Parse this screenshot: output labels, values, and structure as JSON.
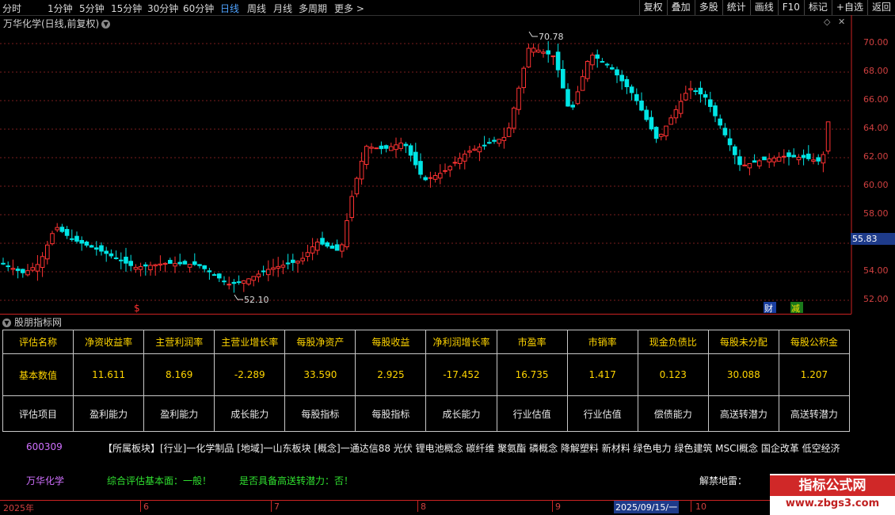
{
  "toolbar": {
    "timeframes": [
      "分时",
      "1分钟",
      "5分钟",
      "15分钟",
      "30分钟",
      "60分钟",
      "日线",
      "周线",
      "月线",
      "多周期",
      "更多 >"
    ],
    "active_timeframe": "日线",
    "buttons": [
      "复权",
      "叠加",
      "多股",
      "统计",
      "画线",
      "F10",
      "标记",
      "+自选",
      "返回"
    ]
  },
  "chart": {
    "title": "万华化学(日线,前复权)",
    "dropdown_icon": "chevron-down-icon",
    "high_label": "70.78",
    "low_label": "52.10",
    "current_price": "55.83",
    "y_ticks": [
      "70.00",
      "68.00",
      "66.00",
      "64.00",
      "62.00",
      "60.00",
      "58.00",
      "56.00",
      "54.00",
      "52.00"
    ],
    "markers": {
      "dividend": "$",
      "finance": "财",
      "reduce": "减"
    },
    "colors": {
      "up": "#ff3232",
      "down": "#00e5e5",
      "grid": "#7a1e1e",
      "axis": "#cc2222"
    }
  },
  "indicator": {
    "name": "股朋指标网",
    "table": {
      "headers": [
        "评估名称",
        "净资收益率",
        "主营利润率",
        "主营业增长率",
        "每股净资产",
        "每股收益",
        "净利润增长率",
        "市盈率",
        "市销率",
        "现金负债比",
        "每股未分配",
        "每股公积金"
      ],
      "values": [
        "基本数值",
        "11.611",
        "8.169",
        "-2.289",
        "33.590",
        "2.925",
        "-17.452",
        "16.735",
        "1.417",
        "0.123",
        "30.088",
        "1.207"
      ],
      "items": [
        "评估项目",
        "盈利能力",
        "盈利能力",
        "成长能力",
        "每股指标",
        "每股指标",
        "成长能力",
        "行业估值",
        "行业估值",
        "偿债能力",
        "高送转潜力",
        "高送转潜力"
      ]
    },
    "code": "600309",
    "sector_text": "【所属板块】[行业]一化学制品 [地域]一山东板块 [概念]一通达信88 光伏 锂电池概念 碳纤维 聚氨酯 磷概念 降解塑料 新材料 绿色电力 绿色建筑 MSCI概念 国企改革 低空经济",
    "stock_name": "万华化学",
    "assessment": "综合评估基本面：一般！",
    "high_transfer": "是否具备高送转潜力：否！",
    "unlock_label": "解禁地雷："
  },
  "date_axis": {
    "labels": [
      "2025年",
      "6",
      "7",
      "8",
      "9",
      "10"
    ],
    "highlight": "2025/09/15/一"
  },
  "watermark": {
    "title": "指标公式网",
    "url": "www.zbgs3.com"
  }
}
